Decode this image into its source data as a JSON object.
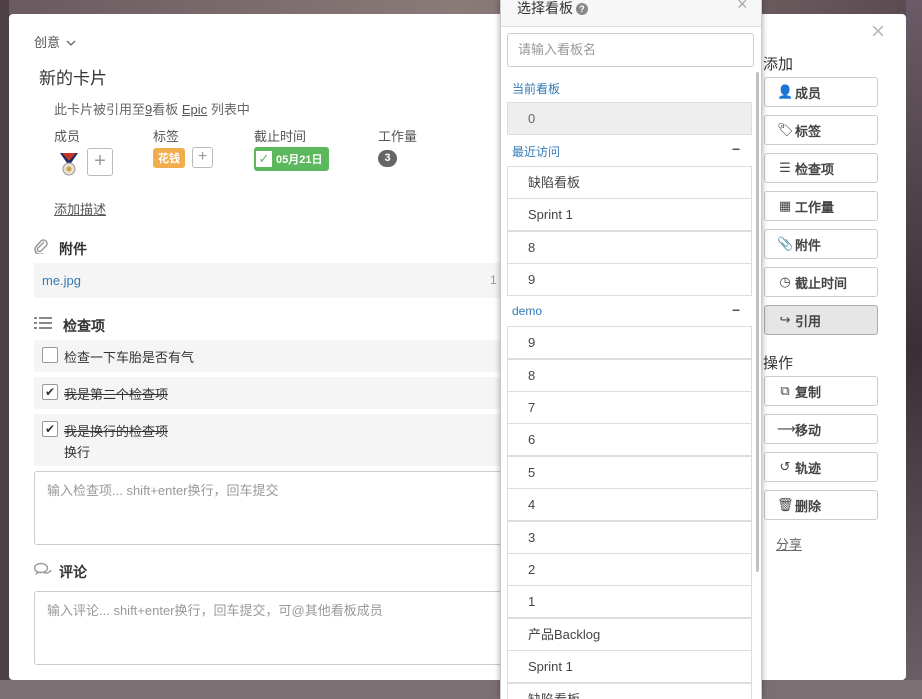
{
  "card": {
    "close_glyph": "×",
    "list_name": "创意",
    "title": "新的卡片",
    "ref_prefix": "此卡片被引用至",
    "ref_count": "9",
    "ref_mid": "看板",
    "ref_board": "Epic",
    "ref_suffix": "列表中",
    "members_label": "成员",
    "tags_label": "标签",
    "due_label": "截止时间",
    "workload_label": "工作量",
    "tag_value": "花钱",
    "due_value": "05月21日",
    "workload_value": "3",
    "add_description": "添加描述",
    "attachments_heading": "附件",
    "attachment_name": "me.jpg",
    "attachment_size_partial": "1",
    "checklist_heading": "检查项",
    "checklist": [
      {
        "text": "检查一下车胎是否有气",
        "done": false
      },
      {
        "text": "我是第二个检查项",
        "done": true
      },
      {
        "text": "我是换行的检查项",
        "text2": "换行",
        "done": true
      }
    ],
    "checklist_placeholder": "输入检查项... shift+enter换行，回车提交",
    "comments_heading": "评论",
    "comment_placeholder": "输入评论... shift+enter换行，回车提交，可@其他看板成员"
  },
  "sidebar": {
    "add_heading": "添加",
    "add_buttons": [
      {
        "label": "成员",
        "icon": "add-user-icon"
      },
      {
        "label": "标签",
        "icon": "tag-icon"
      },
      {
        "label": "检查项",
        "icon": "list-icon"
      },
      {
        "label": "工作量",
        "icon": "grid-icon"
      },
      {
        "label": "附件",
        "icon": "paperclip-icon"
      },
      {
        "label": "截止时间",
        "icon": "clock-icon"
      },
      {
        "label": "引用",
        "icon": "share-arrow-icon"
      }
    ],
    "actions_heading": "操作",
    "action_buttons": [
      {
        "label": "复制",
        "icon": "copy-icon"
      },
      {
        "label": "移动",
        "icon": "arrow-right-icon"
      },
      {
        "label": "轨迹",
        "icon": "history-icon"
      },
      {
        "label": "删除",
        "icon": "trash-icon"
      }
    ],
    "share": "分享"
  },
  "popup": {
    "title": "选择看板",
    "close_glyph": "×",
    "search_placeholder": "请输入看板名",
    "current_label": "当前看板",
    "current_items": [
      "0"
    ],
    "recent_label": "最近访问",
    "recent_items": [
      "缺陷看板",
      "Sprint 1",
      "8",
      "9"
    ],
    "demo_label": "demo",
    "demo_items": [
      "9",
      "8",
      "7",
      "6",
      "5",
      "4",
      "3",
      "2",
      "1",
      "产品Backlog",
      "Sprint 1",
      "缺陷看板"
    ],
    "collapse_glyph": "−"
  }
}
